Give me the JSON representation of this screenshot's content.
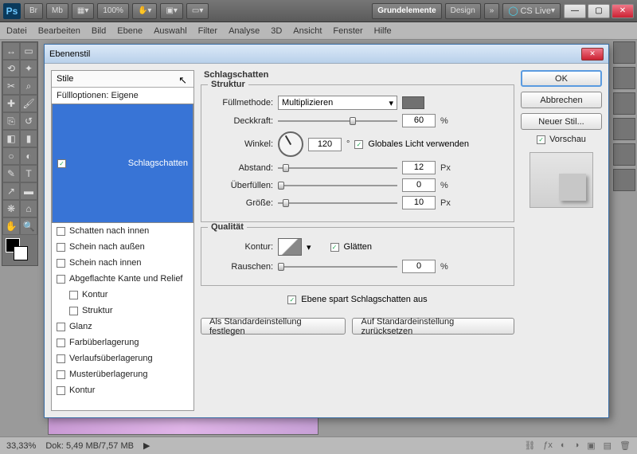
{
  "app": {
    "logo": "Ps",
    "workspace_btn1": "Grundelemente",
    "workspace_btn2": "Design",
    "cslive": "CS Live",
    "zoom": "100%"
  },
  "menu": [
    "Datei",
    "Bearbeiten",
    "Bild",
    "Ebene",
    "Auswahl",
    "Filter",
    "Analyse",
    "3D",
    "Ansicht",
    "Fenster",
    "Hilfe"
  ],
  "dialog": {
    "title": "Ebenenstil",
    "list_header": "Stile",
    "blend_options": "Füllloptionen: Eigene",
    "styles": [
      {
        "label": "Schlagschatten",
        "checked": true,
        "selected": true
      },
      {
        "label": "Schatten nach innen",
        "checked": false
      },
      {
        "label": "Schein nach außen",
        "checked": false
      },
      {
        "label": "Schein nach innen",
        "checked": false
      },
      {
        "label": "Abgeflachte Kante und Relief",
        "checked": false
      },
      {
        "label": "Kontur",
        "checked": false,
        "indent": true
      },
      {
        "label": "Struktur",
        "checked": false,
        "indent": true
      },
      {
        "label": "Glanz",
        "checked": false
      },
      {
        "label": "Farbüberlagerung",
        "checked": false
      },
      {
        "label": "Verlaufsüberlagerung",
        "checked": false
      },
      {
        "label": "Musterüberlagerung",
        "checked": false
      },
      {
        "label": "Kontur",
        "checked": false
      }
    ],
    "panel_title": "Schlagschatten",
    "structure": {
      "legend": "Struktur",
      "blend_label": "Füllmethode:",
      "blend_value": "Multiplizieren",
      "opacity_label": "Deckkraft:",
      "opacity_value": "60",
      "opacity_unit": "%",
      "angle_label": "Winkel:",
      "angle_value": "120",
      "angle_unit": "°",
      "global_label": "Globales Licht verwenden",
      "global_checked": true,
      "distance_label": "Abstand:",
      "distance_value": "12",
      "distance_unit": "Px",
      "spread_label": "Überfüllen:",
      "spread_value": "0",
      "spread_unit": "%",
      "size_label": "Größe:",
      "size_value": "10",
      "size_unit": "Px"
    },
    "quality": {
      "legend": "Qualität",
      "contour_label": "Kontur:",
      "antialias_label": "Glätten",
      "antialias_checked": true,
      "noise_label": "Rauschen:",
      "noise_value": "0",
      "noise_unit": "%"
    },
    "knockout": {
      "label": "Ebene spart Schlagschatten aus",
      "checked": true
    },
    "btn_default": "Als Standardeinstellung festlegen",
    "btn_reset": "Auf Standardeinstellung zurücksetzen",
    "right": {
      "ok": "OK",
      "cancel": "Abbrechen",
      "newstyle": "Neuer Stil...",
      "preview": "Vorschau",
      "preview_checked": true
    }
  },
  "status": {
    "zoom": "33,33%",
    "doc": "Dok: 5,49 MB/7,57 MB"
  }
}
